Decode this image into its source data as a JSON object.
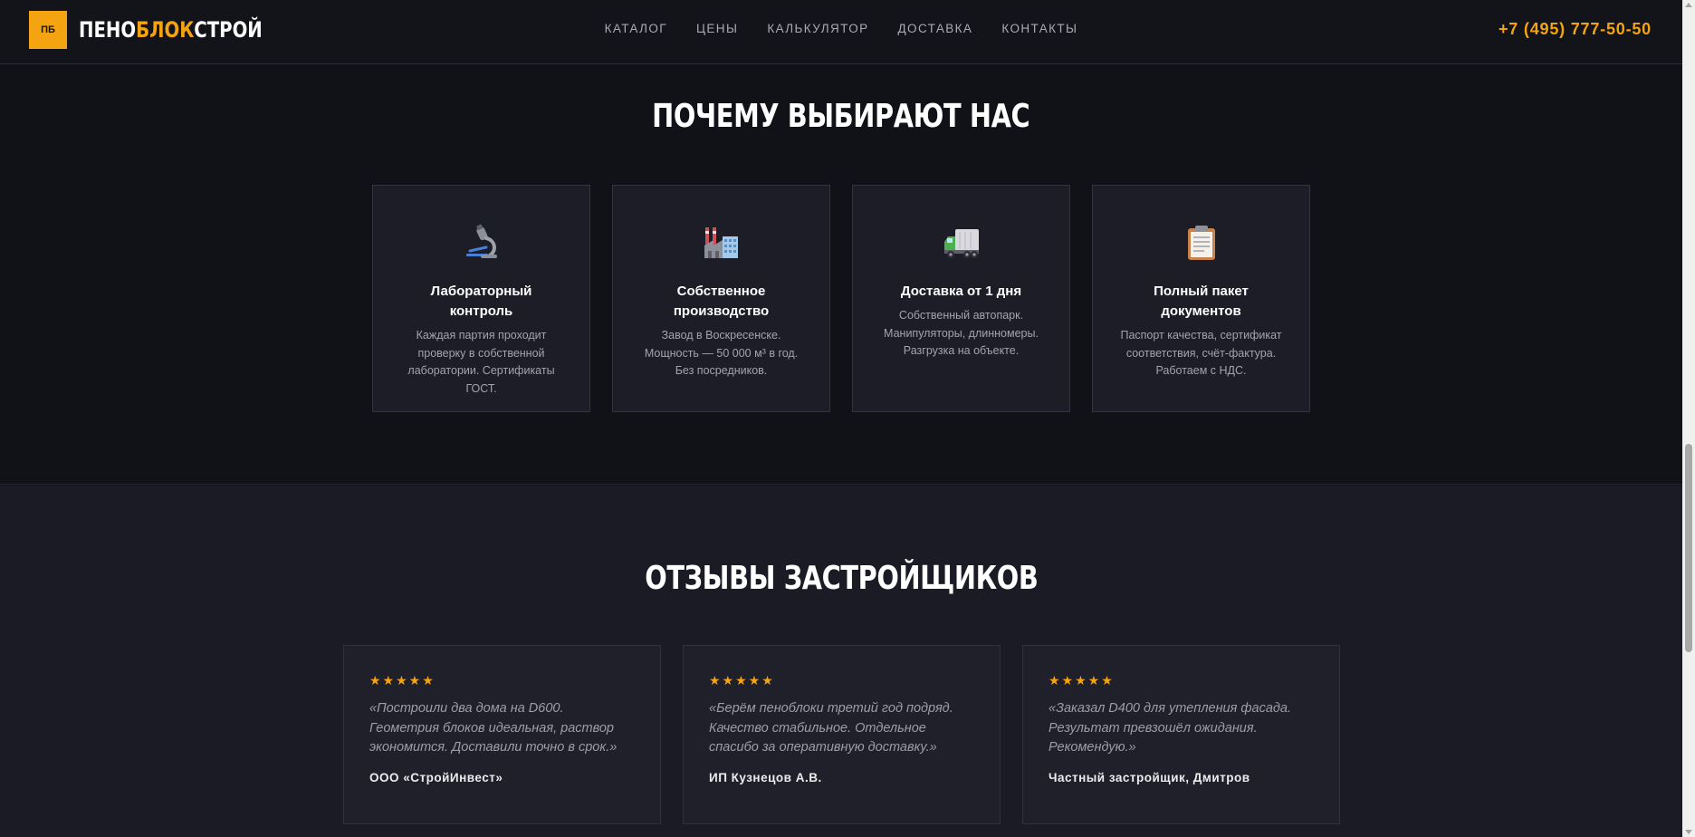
{
  "header": {
    "logo_badge": "ПБ",
    "logo_part1": "ПЕНО",
    "logo_part2": "БЛОК",
    "logo_part3": "СТРОЙ",
    "nav": [
      "КАТАЛОГ",
      "ЦЕНЫ",
      "КАЛЬКУЛЯТОР",
      "ДОСТАВКА",
      "КОНТАКТЫ"
    ],
    "phone": "+7 (495) 777-50-50"
  },
  "why": {
    "title": "ПОЧЕМУ ВЫБИРАЮТ НАС",
    "features": [
      {
        "icon": "microscope-icon",
        "title": "Лабораторный контроль",
        "text": "Каждая партия проходит проверку в собственной лаборатории. Сертификаты ГОСТ."
      },
      {
        "icon": "factory-icon",
        "title": "Собственное производство",
        "text": "Завод в Воскресенске. Мощность — 50 000 м³ в год. Без посредников."
      },
      {
        "icon": "truck-icon",
        "title": "Доставка от 1 дня",
        "text": "Собственный автопарк. Манипуляторы, длинномеры. Разгрузка на объекте."
      },
      {
        "icon": "clipboard-icon",
        "title": "Полный пакет документов",
        "text": "Паспорт качества, сертификат соответствия, счёт-фактура. Работаем с НДС."
      }
    ]
  },
  "reviews": {
    "title": "ОТЗЫВЫ ЗАСТРОЙЩИКОВ",
    "items": [
      {
        "stars": "★★★★★",
        "text": "«Построили два дома на D600. Геометрия блоков идеальная, раствор экономится. Доставили точно в срок.»",
        "author": "ООО «СтройИнвест»"
      },
      {
        "stars": "★★★★★",
        "text": "«Берём пеноблоки третий год подряд. Качество стабильное. Отдельное спасибо за оперативную доставку.»",
        "author": "ИП Кузнецов А.В."
      },
      {
        "stars": "★★★★★",
        "text": "«Заказал D400 для утепления фасада. Результат превзошёл ожидания. Рекомендую.»",
        "author": "Частный застройщик, Дмитров"
      }
    ]
  },
  "colors": {
    "accent": "#f4a410",
    "background": "#111218",
    "card": "#1c1d27"
  }
}
